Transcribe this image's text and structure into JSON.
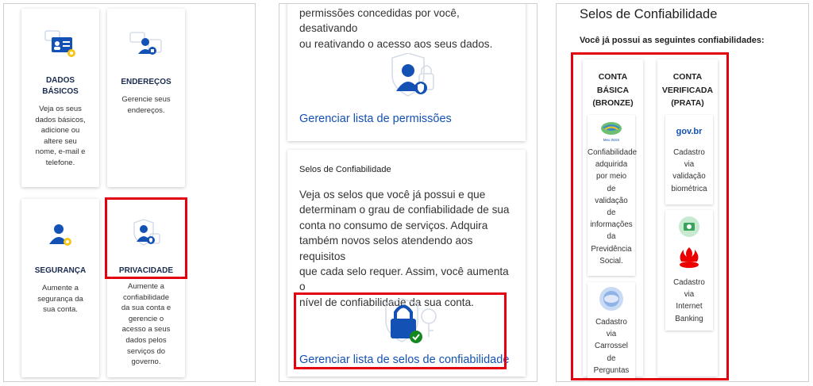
{
  "panel_left": {
    "cards": [
      {
        "title": "DADOS\nBÁSICOS",
        "desc": "Veja os seus\ndados básicos,\nadicione ou\naltere seu\nnome, e-mail e\ntelefone.",
        "icon": "id-card-icon"
      },
      {
        "title": "ENDEREÇOS",
        "desc": "Gerencie seus\nendereços.",
        "icon": "address-icon"
      },
      {
        "title": "SEGURANÇA",
        "desc": "Aumente a\nsegurança da\nsua conta.",
        "icon": "security-icon"
      },
      {
        "title": "PRIVACIDADE",
        "desc": "Aumente a\nconfiabilidade\nda sua conta e\ngerencie o\nacesso a seus\ndados pelos\nserviços do\ngoverno.",
        "icon": "privacy-icon"
      }
    ]
  },
  "panel_middle": {
    "top_text": "permissões concedidas por você, desativando\nou reativando o acesso aos seus dados.",
    "permissions_link": "Gerenciar lista de permissões",
    "seals_title": "Selos de Confiabilidade",
    "seals_text": "Veja os selos que você já possui e que\ndeterminam o grau de confiabilidade de sua\nconta no consumo de serviços. Adquira\ntambém novos selos atendendo aos requisitos\nque cada selo requer. Assim, você aumenta o\nnível de confiabilidade da sua conta.",
    "seals_link": "Gerenciar lista de selos de confiabilidade"
  },
  "panel_right": {
    "title": "Selos de Confiabilidade",
    "subtitle": "Você já possui as seguintes confiabilidades:",
    "columns": [
      {
        "heading": "CONTA\nBÁSICA\n(BRONZE)",
        "seals": [
          {
            "text": "Confiabilidade\nadquirida\npor meio\nde\nvalidação\nde\ninformações\nda\nPrevidência\nSocial.",
            "logo": "previdencia-logo-icon",
            "logo_text": "Meu INSS"
          },
          {
            "text": "Cadastro\nvia\nCarrossel\nde\nPerguntas",
            "logo": "carousel-icon"
          }
        ]
      },
      {
        "heading": "CONTA\nVERIFICADA\n(PRATA)",
        "seals": [
          {
            "text": "Cadastro\nvia\nvalidação\nbiométrica",
            "logo": "gov-br-logo-icon",
            "logo_text": "gov.br"
          },
          {
            "text": "Cadastro\nvia\nInternet\nBanking",
            "logo": "santander-bank-icon"
          }
        ]
      }
    ]
  },
  "colors": {
    "accent": "#1351b4",
    "highlight": "#e3000f",
    "title": "#1a2b4f"
  }
}
